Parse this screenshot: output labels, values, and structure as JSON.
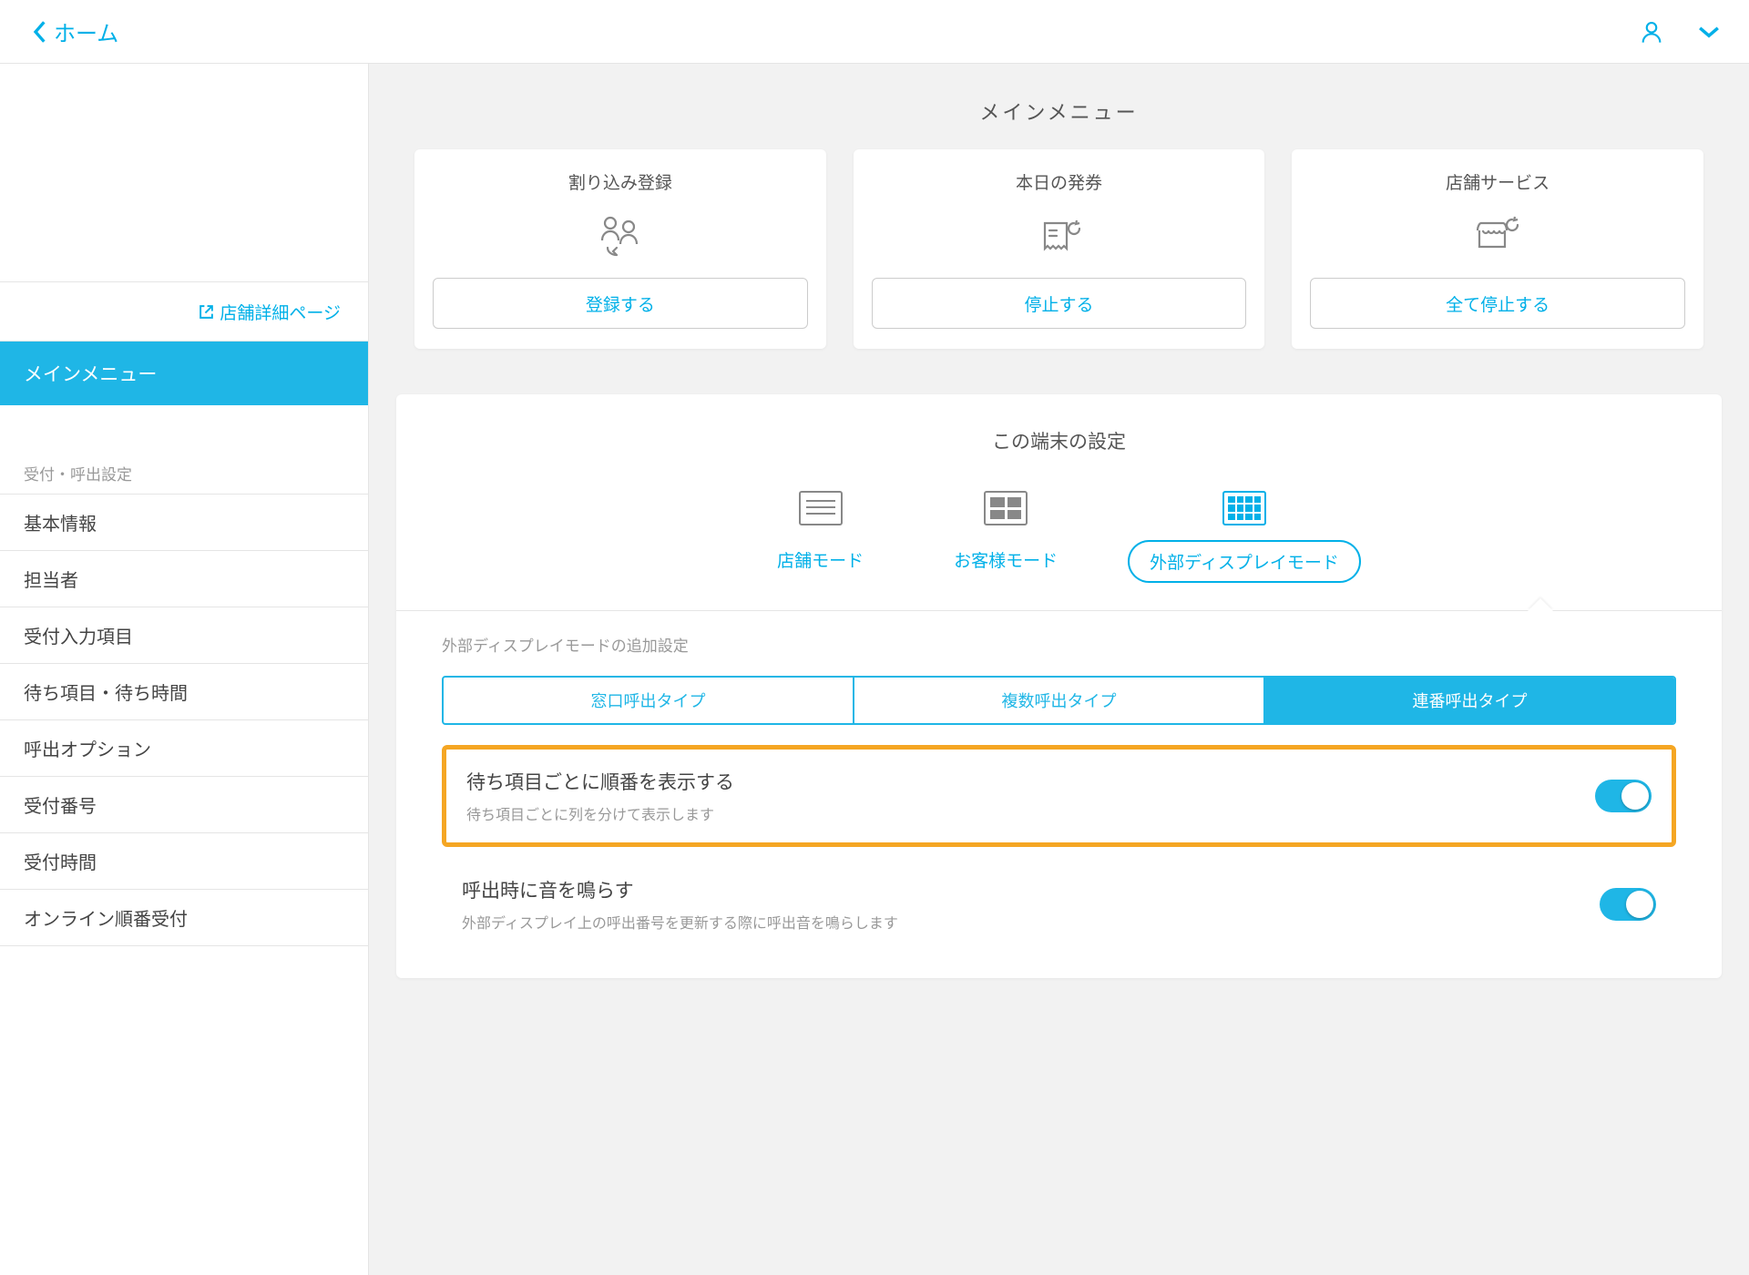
{
  "header": {
    "back_label": "ホーム"
  },
  "sidebar": {
    "detail_link": "店舗詳細ページ",
    "active": "メインメニュー",
    "section": "受付・呼出設定",
    "items": [
      "基本情報",
      "担当者",
      "受付入力項目",
      "待ち項目・待ち時間",
      "呼出オプション",
      "受付番号",
      "受付時間",
      "オンライン順番受付"
    ]
  },
  "main_menu": {
    "title": "メインメニュー",
    "cards": [
      {
        "title": "割り込み登録",
        "button": "登録する"
      },
      {
        "title": "本日の発券",
        "button": "停止する"
      },
      {
        "title": "店舗サービス",
        "button": "全て停止する"
      }
    ]
  },
  "device_settings": {
    "title": "この端末の設定",
    "modes": [
      "店舗モード",
      "お客様モード",
      "外部ディスプレイモード"
    ],
    "sub_title": "外部ディスプレイモードの追加設定",
    "tabs": [
      "窓口呼出タイプ",
      "複数呼出タイプ",
      "連番呼出タイプ"
    ],
    "options": [
      {
        "title": "待ち項目ごとに順番を表示する",
        "desc": "待ち項目ごとに列を分けて表示します"
      },
      {
        "title": "呼出時に音を鳴らす",
        "desc": "外部ディスプレイ上の呼出番号を更新する際に呼出音を鳴らします"
      }
    ]
  }
}
